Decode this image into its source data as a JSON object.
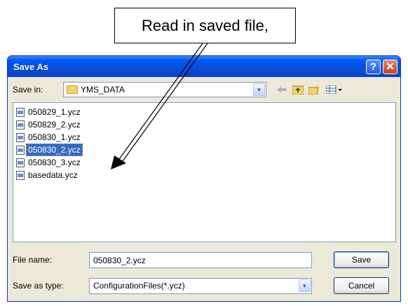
{
  "callout": {
    "text": "Read in saved file,"
  },
  "dialog": {
    "title": "Save As",
    "help_symbol": "?",
    "close_symbol": "✕",
    "save_in_label": "Save in:",
    "save_in_value": "YMS_DATA",
    "toolbar_icons": [
      "back-icon",
      "up-folder-icon",
      "new-folder-icon",
      "views-menu-icon"
    ],
    "files": [
      {
        "name": "050829_1.ycz",
        "selected": false
      },
      {
        "name": "050829_2.ycz",
        "selected": false
      },
      {
        "name": "050830_1.ycz",
        "selected": false
      },
      {
        "name": "050830_2.ycz",
        "selected": true
      },
      {
        "name": "050830_3.ycz",
        "selected": false
      },
      {
        "name": "basedata.ycz",
        "selected": false
      }
    ],
    "file_name_label": "File name:",
    "file_name_value": "050830_2.ycz",
    "save_as_type_label": "Save as type:",
    "save_as_type_value": "ConfigurationFiles(*.ycz)",
    "save_button": "Save",
    "cancel_button": "Cancel"
  },
  "colors": {
    "titlebar": "#0a4bd6",
    "dialog_bg": "#ece9d8",
    "selection": "#316ac5"
  }
}
